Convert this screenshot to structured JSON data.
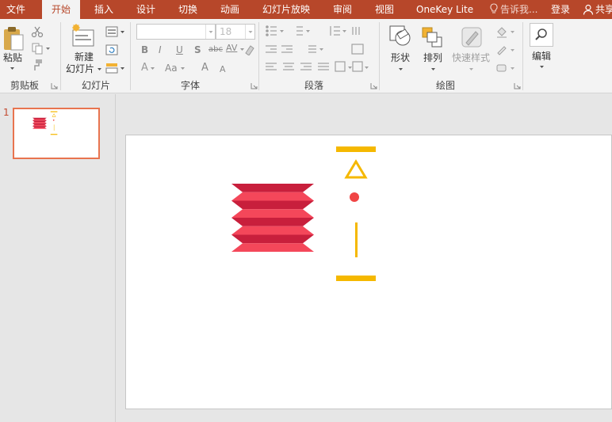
{
  "tabs": [
    {
      "label": "文件",
      "active": false
    },
    {
      "label": "开始",
      "active": true
    },
    {
      "label": "插入",
      "active": false
    },
    {
      "label": "设计",
      "active": false
    },
    {
      "label": "切换",
      "active": false
    },
    {
      "label": "动画",
      "active": false
    },
    {
      "label": "幻灯片放映",
      "active": false
    },
    {
      "label": "审阅",
      "active": false
    },
    {
      "label": "视图",
      "active": false
    },
    {
      "label": "OneKey Lite",
      "active": false
    }
  ],
  "tell_me": "告诉我...",
  "login": "登录",
  "share": "共享",
  "ribbon": {
    "clipboard": {
      "paste_label": "粘贴",
      "group_label": "剪贴板"
    },
    "slides": {
      "new_slide_line1": "新建",
      "new_slide_line2": "幻灯片",
      "group_label": "幻灯片"
    },
    "font": {
      "font_name_value": "",
      "font_size_value": "18",
      "bold": "B",
      "italic": "I",
      "underline": "U",
      "shadow": "S",
      "strike": "abc",
      "spacing": "AV",
      "grow": "A",
      "shrink": "A",
      "case": "Aa",
      "group_label": "字体"
    },
    "paragraph": {
      "group_label": "段落"
    },
    "drawing": {
      "shapes_label": "形状",
      "arrange_label": "排列",
      "quick_styles_label": "快速样式",
      "group_label": "绘图"
    },
    "editing": {
      "label": "编辑"
    }
  },
  "slide_panel": {
    "slide_number": "1"
  },
  "colors": {
    "accent": "#b7472a",
    "lantern_red_light": "#f4475a",
    "lantern_red_dark": "#c81f3c",
    "gold": "#f5b800",
    "dot_red": "#f04545"
  }
}
